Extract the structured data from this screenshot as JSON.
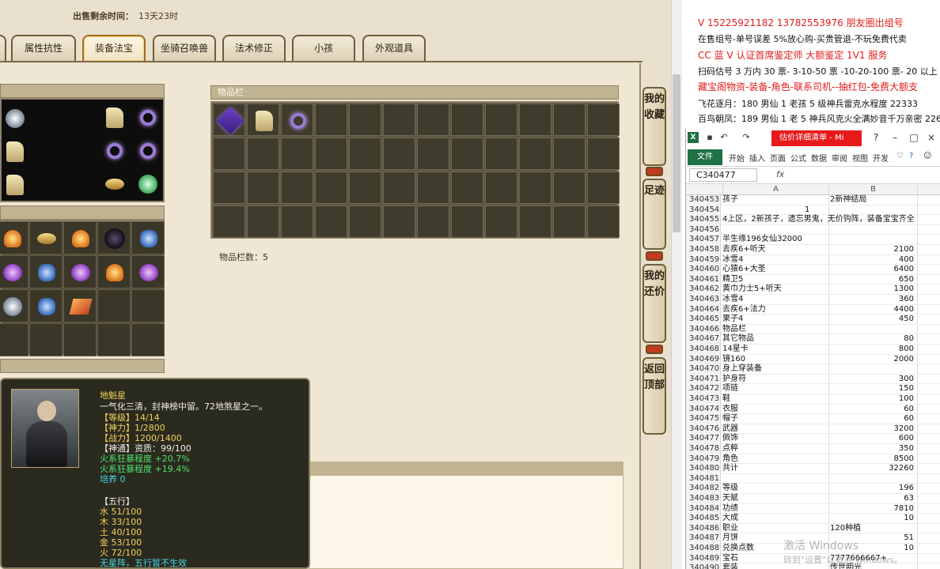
{
  "game": {
    "sale_time_label": "出售剩余时间：",
    "sale_time_value": "13天23时",
    "tabs": [
      {
        "label": "属性抗性"
      },
      {
        "label": "装备法宝"
      },
      {
        "label": "坐骑召唤兽"
      },
      {
        "label": "法术修正"
      },
      {
        "label": "小孩"
      },
      {
        "label": "外观道具"
      }
    ],
    "active_tab": "装备法宝",
    "inventory_header": "物品栏",
    "inventory_count": "物品栏数：5",
    "side_buttons": [
      "我的收藏",
      "足迹",
      "我的还价",
      "返回顶部"
    ],
    "tooltip": {
      "name": "地魁星",
      "desc": "一气化三清，封神榜中留。72地煞星之一。",
      "level": "【等级】14/14",
      "shenli": "【神力】1/2800",
      "zhanli": "【战力】1200/1400",
      "shentong": "【神通】资质：99/100",
      "fire1": "火系狂暴程度 +20.7%",
      "fire2": "火系狂暴程度 +19.4%",
      "peiyang": "培养 0",
      "wuxing_title": "【五行】",
      "water": "水 51/100",
      "wood": "木 33/100",
      "earth": "土 40/100",
      "metal": "金 53/100",
      "fire": "火 72/100",
      "formation": "无星阵，五行暂不生效"
    }
  },
  "ads": {
    "line1": "V 15225921182   13782553976 朋友圈出组号",
    "line2": "在售组号-单号误差 5%放心购-买贵管退-不玩免费代卖",
    "line3": "CC 蓝 V 认证首席鉴定师 大额鉴定 1V1 服务",
    "line4": "扫码估号 3 万内 30 票- 3-10-50 票 -10-20-100 票- 20 以上 150",
    "line5": "藏宝阁物资-装备-角色-联系司机--抽红包-免费大额支",
    "line6": "飞花逐月：180 男仙 1 老孩 5 级神兵雷克水程度 22333",
    "line7": "百鸟朝凤：189 男仙 1 老 5 神兵风克火全满妙音千万亲密 226"
  },
  "excel": {
    "logo": "X",
    "doc_title": "估价详细清单 - Mi",
    "file_tab": "文件",
    "ribbon": [
      "开始",
      "插入",
      "页面",
      "公式",
      "数据",
      "审阅",
      "视图",
      "开发"
    ],
    "name_box": "C340477",
    "fx": "fx",
    "col_a": "A",
    "col_b": "B",
    "rows": [
      {
        "n": "340453",
        "a": "孩子",
        "b": "2新神结局",
        "bl": true
      },
      {
        "n": "340454",
        "a": "",
        "b": "",
        "mid": "1"
      },
      {
        "n": "340455",
        "a": "4上区，2新孩子，遗忘男鬼，无价钩阵，装备宝宝齐全",
        "b": ""
      },
      {
        "n": "340456",
        "a": "",
        "b": ""
      },
      {
        "n": "340457",
        "a": "半生缘196女仙32000",
        "b": ""
      },
      {
        "n": "340458",
        "a": "去疾6+听天",
        "b": "2100"
      },
      {
        "n": "340459",
        "a": "冰雪4",
        "b": "400"
      },
      {
        "n": "340460",
        "a": "心猿6+大圣",
        "b": "6400"
      },
      {
        "n": "340461",
        "a": "精卫5",
        "b": "650"
      },
      {
        "n": "340462",
        "a": "黄巾力士5+听天",
        "b": "1300"
      },
      {
        "n": "340463",
        "a": "冰雪4",
        "b": "360"
      },
      {
        "n": "340464",
        "a": "去疾6+法力",
        "b": "4400"
      },
      {
        "n": "340465",
        "a": "果子4",
        "b": "450"
      },
      {
        "n": "340466",
        "a": "物品栏",
        "b": ""
      },
      {
        "n": "340467",
        "a": "其它物品",
        "b": "80"
      },
      {
        "n": "340468",
        "a": "14星卡",
        "b": "800"
      },
      {
        "n": "340469",
        "a": "镜160",
        "b": "2000"
      },
      {
        "n": "340470",
        "a": "身上穿装备",
        "b": ""
      },
      {
        "n": "340471",
        "a": "护身符",
        "b": "300"
      },
      {
        "n": "340472",
        "a": "项链",
        "b": "150"
      },
      {
        "n": "340473",
        "a": "鞋",
        "b": "100"
      },
      {
        "n": "340474",
        "a": "衣服",
        "b": "60"
      },
      {
        "n": "340475",
        "a": "帽子",
        "b": "60"
      },
      {
        "n": "340476",
        "a": "武器",
        "b": "3200"
      },
      {
        "n": "340477",
        "a": "佩饰",
        "b": "600"
      },
      {
        "n": "340478",
        "a": "点粹",
        "b": "350"
      },
      {
        "n": "340479",
        "a": "角色",
        "b": "8500"
      },
      {
        "n": "340480",
        "a": "共计",
        "b": "32260"
      },
      {
        "n": "340481",
        "a": "",
        "b": ""
      },
      {
        "n": "340482",
        "a": "等级",
        "b": "196"
      },
      {
        "n": "340483",
        "a": "天赋",
        "b": "63"
      },
      {
        "n": "340484",
        "a": "功绩",
        "b": "7810"
      },
      {
        "n": "340485",
        "a": "大成",
        "b": "10"
      },
      {
        "n": "340486",
        "a": "职业",
        "b": "120种植",
        "bl": true
      },
      {
        "n": "340487",
        "a": "月饼",
        "b": "51"
      },
      {
        "n": "340488",
        "a": "兑换点数",
        "b": "10"
      },
      {
        "n": "340489",
        "a": "宝石",
        "b": "7777666667+",
        "bl": true
      },
      {
        "n": "340490",
        "a": "套装",
        "b": "传世明光",
        "bl": true
      }
    ]
  },
  "watermark": {
    "line1": "激活 Windows",
    "line2": "转到\"设置\"以激活 Windows。"
  }
}
